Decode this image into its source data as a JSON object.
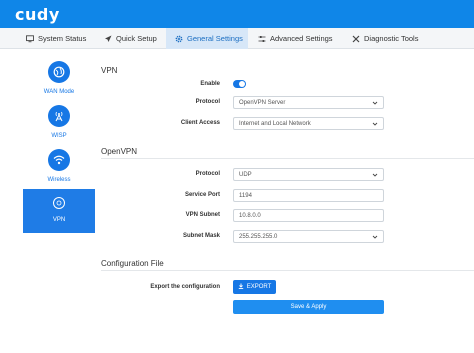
{
  "header": {
    "logo": "cudy"
  },
  "tabs": [
    {
      "label": "System Status",
      "icon": "monitor-icon"
    },
    {
      "label": "Quick Setup",
      "icon": "rocket-icon"
    },
    {
      "label": "General Settings",
      "icon": "gear-icon",
      "active": true
    },
    {
      "label": "Advanced Settings",
      "icon": "sliders-icon"
    },
    {
      "label": "Diagnostic Tools",
      "icon": "tools-icon"
    }
  ],
  "sidebar": {
    "items": [
      {
        "label": "WAN Mode",
        "icon": "globe-icon"
      },
      {
        "label": "WISP",
        "icon": "antenna-icon"
      },
      {
        "label": "Wireless",
        "icon": "wifi-icon"
      },
      {
        "label": "VPN",
        "icon": "vpn-icon",
        "active": true
      }
    ]
  },
  "vpn": {
    "title": "VPN",
    "enable_label": "Enable",
    "enabled": true,
    "protocol_label": "Protocol",
    "protocol_value": "OpenVPN Server",
    "client_access_label": "Client Access",
    "client_access_value": "Internet and Local Network"
  },
  "openvpn": {
    "title": "OpenVPN",
    "protocol_label": "Protocol",
    "protocol_value": "UDP",
    "service_port_label": "Service Port",
    "service_port_value": "1194",
    "subnet_label": "VPN Subnet",
    "subnet_value": "10.8.0.0",
    "mask_label": "Subnet Mask",
    "mask_value": "255.255.255.0"
  },
  "config": {
    "title": "Configuration File",
    "export_label": "Export the configuration",
    "export_button": "EXPORT",
    "save_button": "Save & Apply"
  },
  "colors": {
    "brand": "#0f86e8",
    "accent": "#1677e5",
    "active_tab_bg": "#d7e7f8"
  }
}
